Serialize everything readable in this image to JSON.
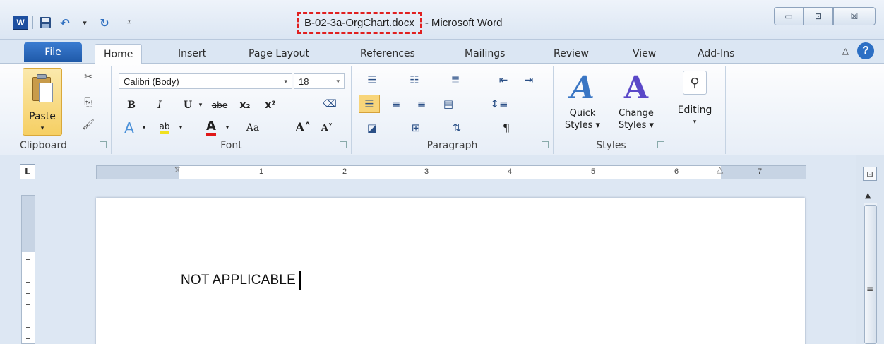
{
  "window": {
    "file_name": "B-02-3a-OrgChart.docx",
    "title_separator": "-",
    "app_name": "Microsoft Word",
    "minimize_glyph": "▭",
    "maximize_glyph": "⊡",
    "close_glyph": "☒"
  },
  "quick_access": {
    "word_logo_letter": "W",
    "save_icon": "save-icon",
    "undo_icon": "undo-icon",
    "redo_icon": "redo-icon"
  },
  "tabs": [
    {
      "label": "File"
    },
    {
      "label": "Home"
    },
    {
      "label": "Insert"
    },
    {
      "label": "Page Layout"
    },
    {
      "label": "References"
    },
    {
      "label": "Mailings"
    },
    {
      "label": "Review"
    },
    {
      "label": "View"
    },
    {
      "label": "Add-Ins"
    }
  ],
  "help_label": "?",
  "ribbon": {
    "clipboard": {
      "label": "Clipboard",
      "paste_label": "Paste"
    },
    "font": {
      "label": "Font",
      "font_name": "Calibri (Body)",
      "font_size": "18",
      "bold": "B",
      "italic": "I",
      "underline": "U",
      "strikethrough": "abe",
      "subscript": "x₂",
      "superscript": "x²",
      "change_case": "Aa",
      "grow_font": "A˄",
      "shrink_font": "A˅"
    },
    "paragraph": {
      "label": "Paragraph",
      "pilcrow": "¶"
    },
    "styles": {
      "label": "Styles",
      "quick_styles_line1": "Quick",
      "quick_styles_line2": "Styles ▾",
      "change_styles_line1": "Change",
      "change_styles_line2": "Styles ▾"
    },
    "editing": {
      "label": "Editing"
    }
  },
  "ruler": {
    "corner_label": "L",
    "numbers": [
      "1",
      "2",
      "3",
      "4",
      "5",
      "6",
      "7"
    ]
  },
  "document": {
    "text": "NOT APPLICABLE"
  }
}
